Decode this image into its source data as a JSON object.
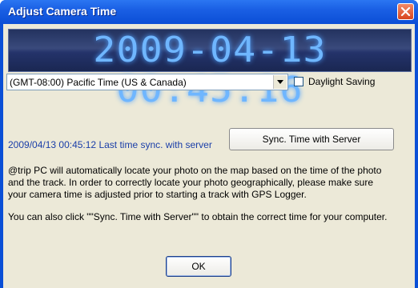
{
  "window": {
    "title": "Adjust Camera Time"
  },
  "clock": {
    "display": "2009-04-13 00:45:16"
  },
  "timezone": {
    "selected": "(GMT-08:00) Pacific Time (US & Canada)"
  },
  "daylight_saving": {
    "label": "Daylight Saving",
    "checked": false
  },
  "sync": {
    "status_text": "2009/04/13 00:45:12 Last time sync. with server",
    "button_label": "Sync. Time with Server"
  },
  "info": {
    "paragraph1": "@trip PC will automatically locate your photo on the map based on the time of the photo and the track. In order to correctly locate your photo geographically, please make sure your camera time is adjusted prior to starting a track with GPS Logger.",
    "paragraph2": "You can also click \"\"Sync. Time with Server\"\" to obtain the correct time for your computer."
  },
  "buttons": {
    "ok_label": "OK"
  },
  "icons": {
    "close": "close-icon",
    "dropdown": "chevron-down-icon"
  },
  "colors": {
    "titlebar": "#0b4ed6",
    "clock_digits": "#6fb6ff",
    "sync_text": "#1a3ea8",
    "close_button": "#d8451e"
  }
}
